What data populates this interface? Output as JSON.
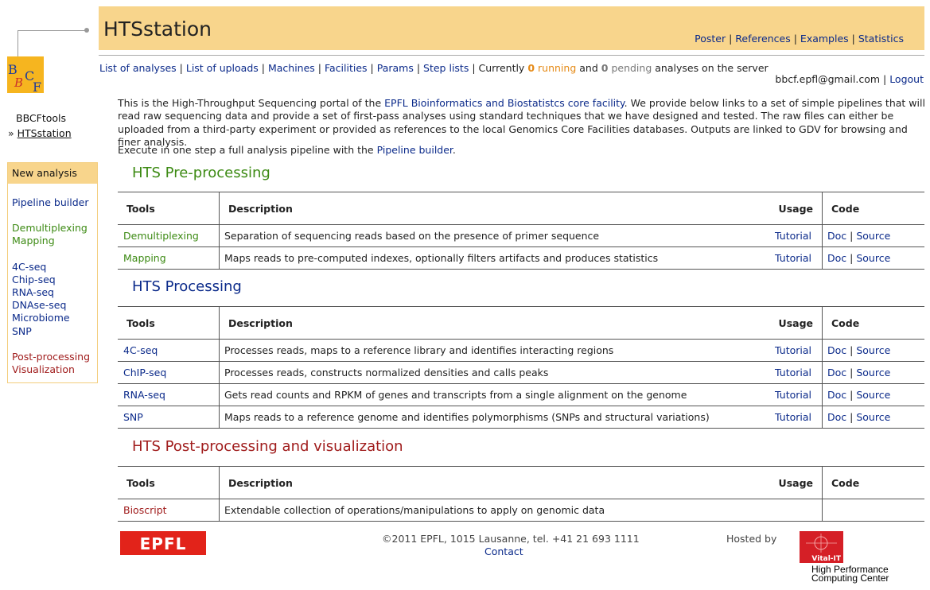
{
  "app": {
    "title": "HTSstation"
  },
  "top_links": [
    "Poster",
    "References",
    "Examples",
    "Statistics"
  ],
  "logo_letters": "BBCF",
  "side_links": [
    {
      "label": "BBCFtools",
      "current": false
    },
    {
      "label": "HTSstation",
      "current": true
    }
  ],
  "current_marker": "»",
  "nav": {
    "links": [
      "List of analyses",
      "List of uploads",
      "Machines",
      "Facilities",
      "Params",
      "Step lists"
    ],
    "status_prefix": "Currently",
    "running_count": "0",
    "running_label": "running",
    "and": "and",
    "pending_count": "0",
    "pending_label": "pending",
    "status_suffix": "analyses on the server"
  },
  "user": {
    "email": "bbcf.epfl@gmail.com",
    "logout": "Logout"
  },
  "intro": {
    "p1_before": "This is the High-Throughput Sequencing portal of the ",
    "p1_link": "EPFL Bioinformatics and Biostatistcs core facility",
    "p1_after": ". We provide below links to a set of simple pipelines that will read raw sequencing data and provide a set of first-pass analyses using standard techniques that we have designed and tested. The raw files can either be uploaded from a third-party experiment or provided as references to the local Genomics Core Facilities databases. Outputs are linked to GDV for browsing and finer analysis.",
    "p2_before": "Execute in one step a full analysis pipeline with the ",
    "p2_link": "Pipeline builder",
    "p2_after": "."
  },
  "left_menu": {
    "header": "New analysis",
    "groups": [
      {
        "color": "blue",
        "items": [
          "Pipeline builder"
        ]
      },
      {
        "color": "green",
        "items": [
          "Demultiplexing",
          "Mapping"
        ]
      },
      {
        "color": "blue",
        "items": [
          "4C-seq",
          "Chip-seq",
          "RNA-seq",
          "DNAse-seq",
          "Microbiome",
          "SNP"
        ]
      },
      {
        "color": "red",
        "items": [
          "Post-processing",
          "Visualization"
        ]
      }
    ]
  },
  "table_headers": {
    "tools": "Tools",
    "description": "Description",
    "usage": "Usage",
    "code": "Code"
  },
  "sections": [
    {
      "title": "HTS Pre-processing",
      "color": "green",
      "rows": [
        {
          "tool": "Demultiplexing",
          "description": "Separation of sequencing reads based on the presence of primer sequence",
          "usage": "Tutorial",
          "doc": "Doc",
          "source": "Source"
        },
        {
          "tool": "Mapping",
          "description": "Maps reads to pre-computed indexes, optionally filters artifacts and produces statistics",
          "usage": "Tutorial",
          "doc": "Doc",
          "source": "Source"
        }
      ]
    },
    {
      "title": "HTS Processing",
      "color": "blue",
      "rows": [
        {
          "tool": "4C-seq",
          "description": "Processes reads, maps to a reference library and identifies interacting regions",
          "usage": "Tutorial",
          "doc": "Doc",
          "source": "Source"
        },
        {
          "tool": "ChIP-seq",
          "description": "Processes reads, constructs normalized densities and calls peaks",
          "usage": "Tutorial",
          "doc": "Doc",
          "source": "Source"
        },
        {
          "tool": "RNA-seq",
          "description": "Gets read counts and RPKM of genes and transcripts from a single alignment on the genome",
          "usage": "Tutorial",
          "doc": "Doc",
          "source": "Source"
        },
        {
          "tool": "SNP",
          "description": "Maps reads to a reference genome and identifies polymorphisms (SNPs and structural variations)",
          "usage": "Tutorial",
          "doc": "Doc",
          "source": "Source"
        }
      ]
    },
    {
      "title": "HTS Post-processing and visualization",
      "color": "red",
      "rows": [
        {
          "tool": "Bioscript",
          "description": "Extendable collection of operations/manipulations to apply on genomic data",
          "usage": "",
          "doc": "",
          "source": ""
        }
      ]
    }
  ],
  "footer": {
    "copyright": "©2011 EPFL, 1015 Lausanne, tel. +41 21 693 1111",
    "contact": "Contact",
    "hosted_by": "Hosted by",
    "epfl_logo": "EPFL",
    "vital_logo": "Vital-IT",
    "hpc_line1": "High Performance",
    "hpc_line2": "Computing Center"
  },
  "colors": {
    "header_bg": "#f8d58c",
    "link": "#0b2a8a",
    "green": "#3c8a13",
    "red": "#a01c1c",
    "orange": "#e58a16"
  }
}
